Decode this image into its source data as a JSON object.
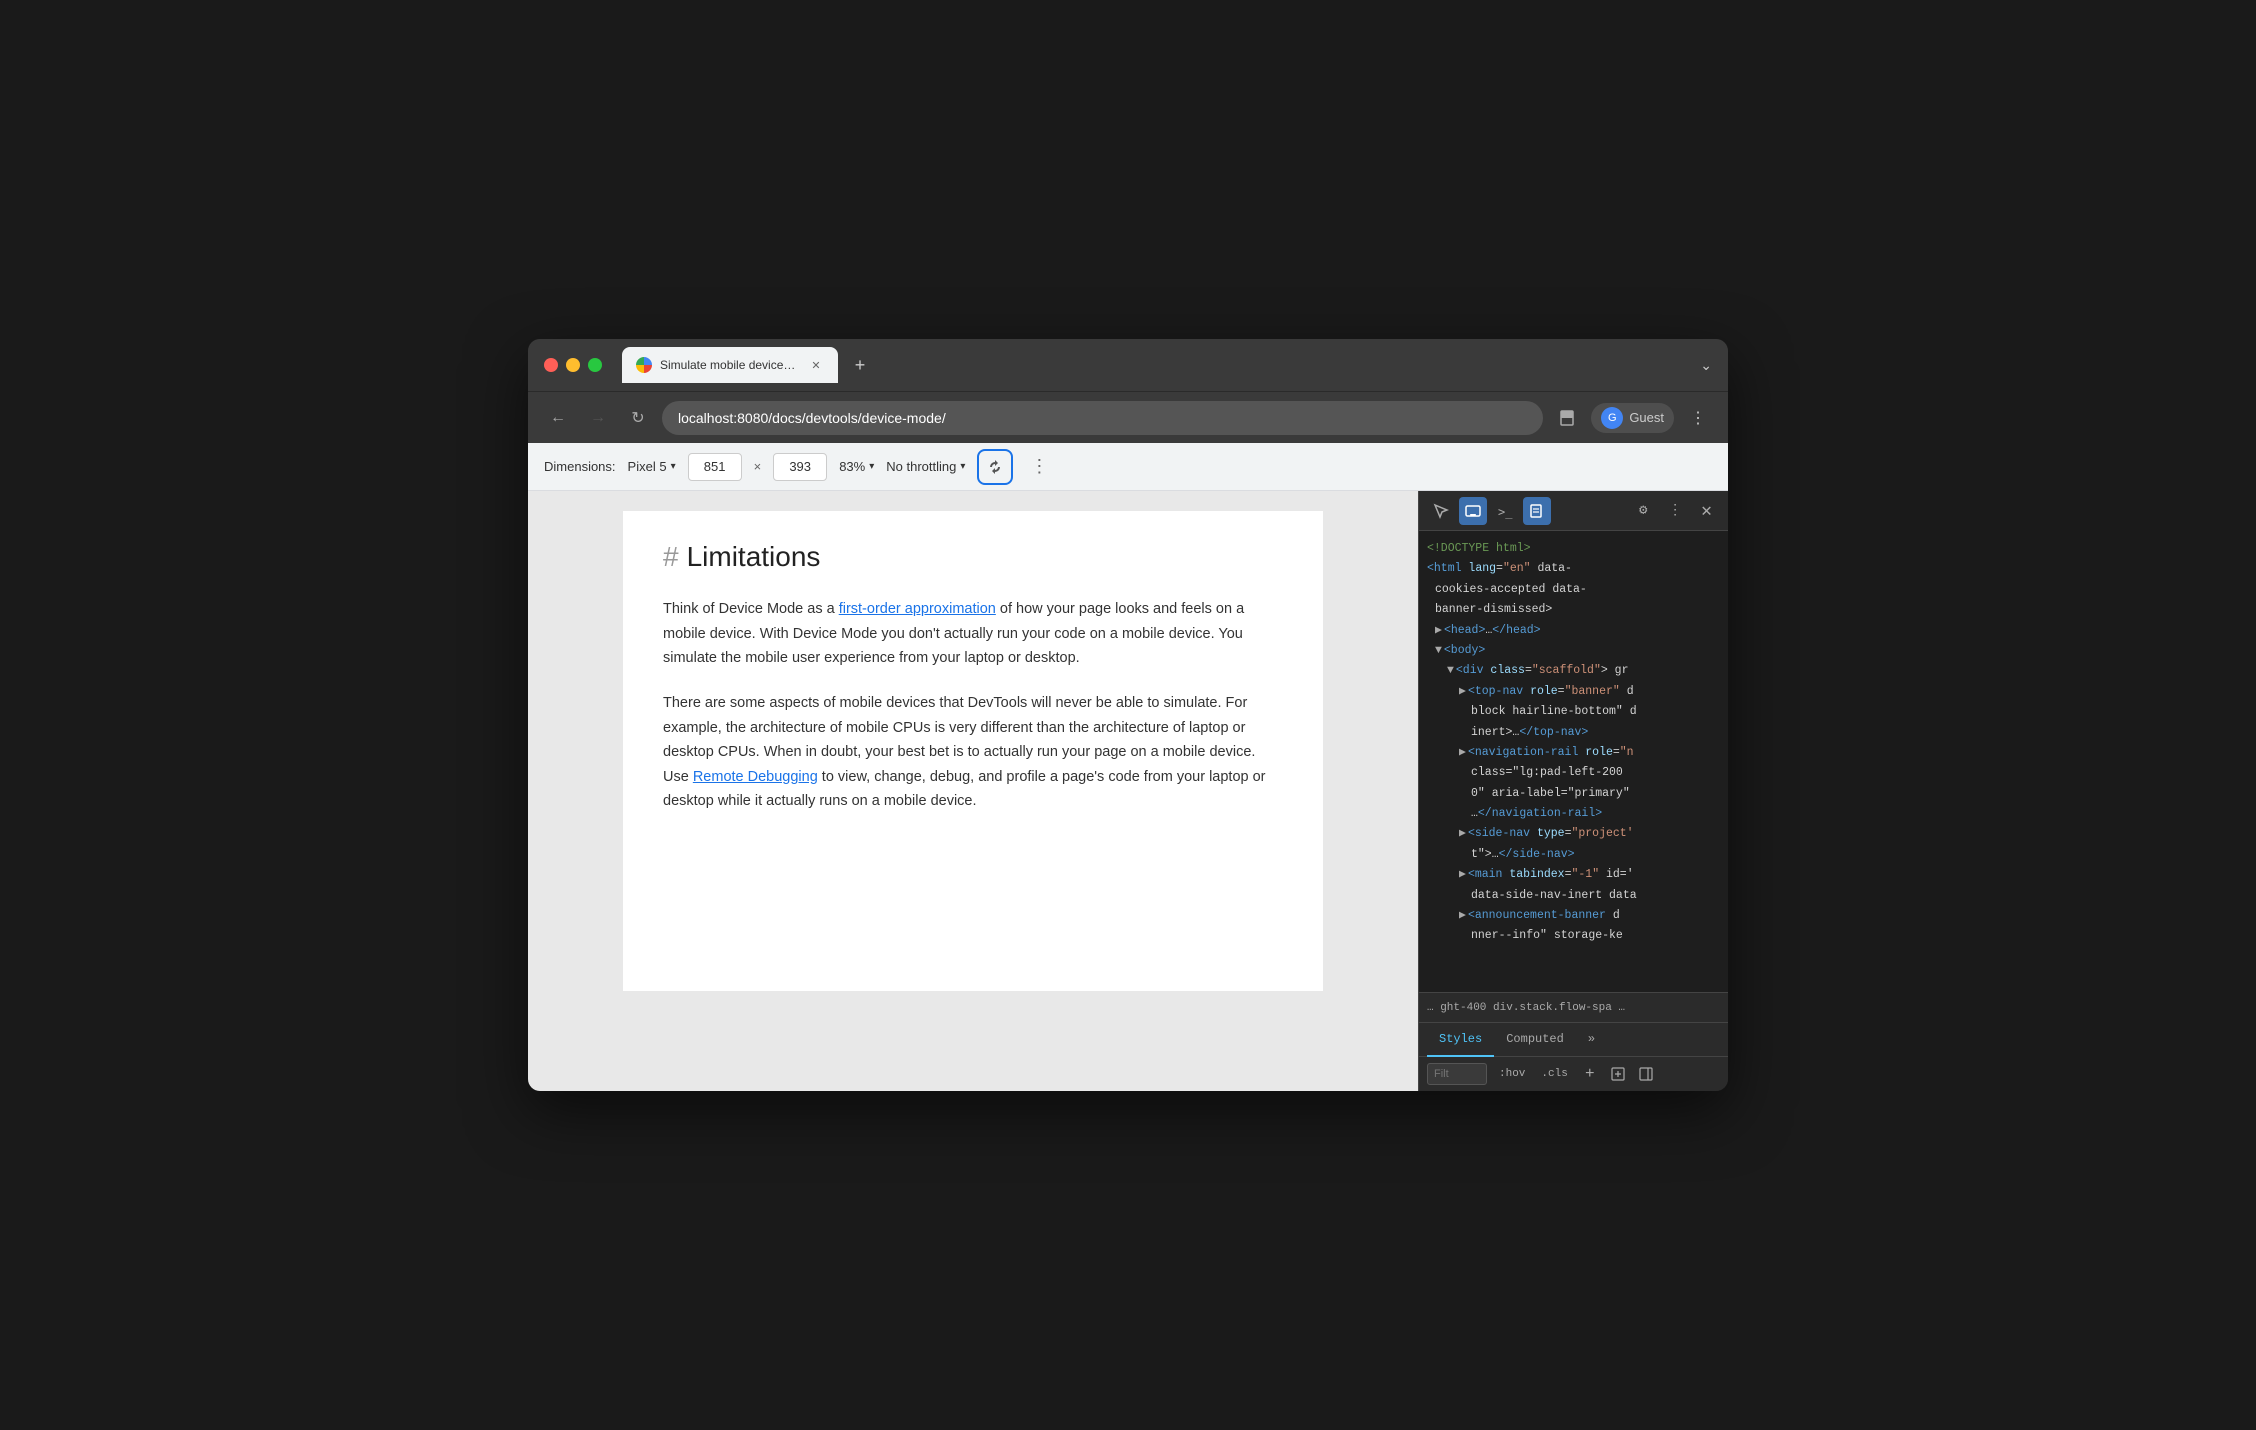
{
  "window": {
    "title": "Simulate mobile devices with Chrome DevTools",
    "tab_title": "Simulate mobile devices with D",
    "url": "localhost:8080/docs/devtools/device-mode/"
  },
  "traffic_lights": {
    "red": "red",
    "yellow": "yellow",
    "green": "green"
  },
  "nav": {
    "back_disabled": false,
    "forward_disabled": true
  },
  "address": {
    "value": "localhost:8080/docs/devtools/device-mode/"
  },
  "profile": {
    "label": "Guest"
  },
  "device_toolbar": {
    "dimensions_label": "Dimensions:",
    "device_name": "Pixel 5",
    "width": "851",
    "height": "393",
    "x": "×",
    "zoom": "83%",
    "throttle": "No throttling",
    "more_options": "⋮"
  },
  "page": {
    "heading_hash": "#",
    "heading": "Limitations",
    "para1_before_link": "Think of Device Mode as a ",
    "para1_link": "first-order approximation",
    "para1_after_link": " of how your page looks and feels on a mobile device. With Device Mode you don't actually run your code on a mobile device. You simulate the mobile user experience from your laptop or desktop.",
    "para2_before_link": "There are some aspects of mobile devices that DevTools will never be able to simulate. For example, the architecture of mobile CPUs is very different than the architecture of laptop or desktop CPUs. When in doubt, your best bet is to actually run your page on a mobile device. Use ",
    "para2_link": "Remote Debugging",
    "para2_after_link": " to view, change, debug, and profile a page's code from your laptop or desktop while it actually runs on a mobile device."
  },
  "devtools": {
    "html_comment": "<!DOCTYPE html>",
    "line1": "<html lang=\"en\" data-",
    "line1b": "cookies-accepted data-",
    "line1c": "banner-dismissed>",
    "line2": "▶ <head>…</head>",
    "line3": "▼ <body>",
    "line4": "▼ <div class=\"scaffold\"> gr",
    "line5": "▶ <top-nav role=\"banner\" d",
    "line6": " block hairline-bottom\" d",
    "line7": " inert>…</top-nav>",
    "line8": "▶ <navigation-rail role=\"n",
    "line9": " class=\"lg:pad-left-200 ",
    "line10": " 0\" aria-label=\"primary\"",
    "line11": " …</navigation-rail>",
    "line12": "▶ <side-nav type=\"project'",
    "line13": " t\">…</side-nav>",
    "line14": "▶ <main tabindex=\"-1\" id='",
    "line15": " data-side-nav-inert data",
    "line16": "▶ <announcement-banner d",
    "line17": " nner--info\" storage-ke",
    "breadcrumb": "…  ght-400  div.stack.flow-spa  …",
    "tab_styles": "Styles",
    "tab_computed": "Computed",
    "tab_more": "»",
    "filter_placeholder": "Filt",
    "filter_hov": ":hov",
    "filter_cls": ".cls"
  }
}
